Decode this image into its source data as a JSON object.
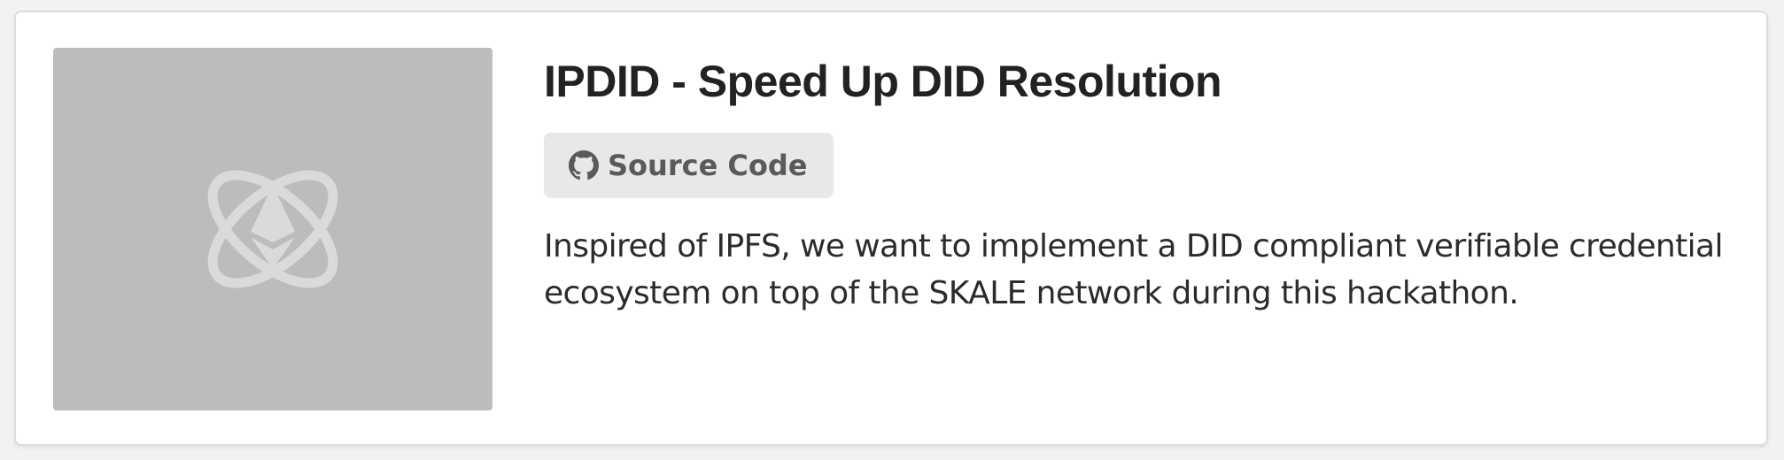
{
  "project": {
    "title": "IPDID - Speed Up DID Resolution",
    "source_button_label": "Source Code",
    "description": "Inspired of IPFS, we want to implement a DID compliant verifiable credential ecosystem on top of the SKALE network during this hackathon.",
    "thumbnail_icon": "ethereum-atom-placeholder-icon",
    "button_icon": "github-icon"
  },
  "colors": {
    "thumbnail_bg": "#bbbcbe",
    "button_bg": "#e8e8e9",
    "title_text": "#222222"
  }
}
